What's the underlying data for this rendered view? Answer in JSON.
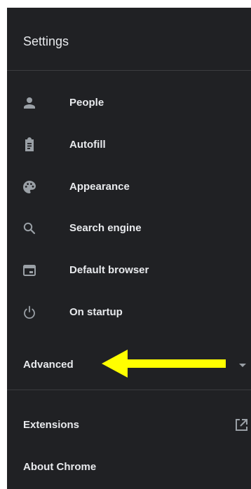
{
  "header": {
    "title": "Settings"
  },
  "nav": {
    "items": [
      {
        "label": "People",
        "icon": "person-icon"
      },
      {
        "label": "Autofill",
        "icon": "clipboard-icon"
      },
      {
        "label": "Appearance",
        "icon": "palette-icon"
      },
      {
        "label": "Search engine",
        "icon": "search-icon"
      },
      {
        "label": "Default browser",
        "icon": "browser-icon"
      },
      {
        "label": "On startup",
        "icon": "power-icon"
      }
    ],
    "advanced": {
      "label": "Advanced",
      "icon": "caret-down-icon"
    },
    "extensions": {
      "label": "Extensions",
      "icon": "open-in-new-icon"
    },
    "about": {
      "label": "About Chrome"
    }
  },
  "annotation": {
    "arrow_color": "#ffff00",
    "icon": "arrow-left-icon"
  },
  "colors": {
    "background": "#202124",
    "text": "#e8eaed",
    "icon": "#9aa0a6",
    "divider": "#3c3d40"
  }
}
